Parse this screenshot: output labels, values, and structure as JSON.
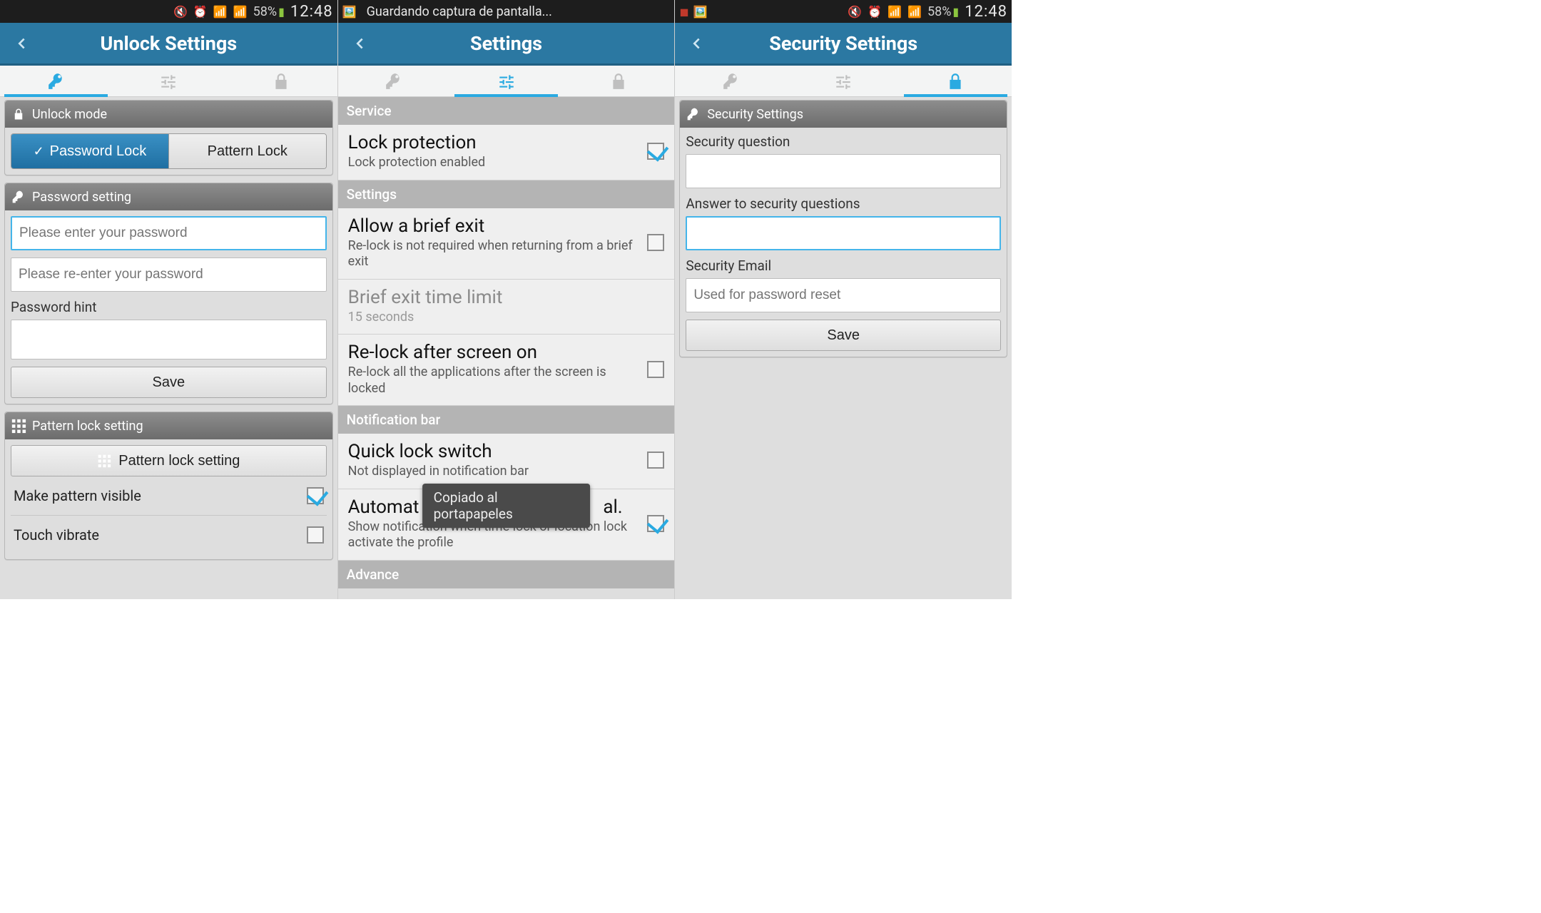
{
  "statusbar": {
    "battery_pct": "58%",
    "clock": "12:48",
    "screenshot_saving": "Guardando captura de pantalla..."
  },
  "screens": {
    "unlock": {
      "header": {
        "title": "Unlock Settings"
      },
      "unlock_mode": {
        "header": "Unlock mode",
        "password_lock": "Password Lock",
        "pattern_lock": "Pattern Lock"
      },
      "password_setting": {
        "header": "Password setting",
        "pw_placeholder": "Please enter your password",
        "pw2_placeholder": "Please re-enter your password",
        "hint_label": "Password hint",
        "save": "Save"
      },
      "pattern_setting": {
        "header": "Pattern lock setting",
        "button": "Pattern lock setting",
        "make_visible": "Make pattern visible",
        "touch_vibrate": "Touch vibrate"
      }
    },
    "settings": {
      "header": {
        "title": "Settings"
      },
      "sections": {
        "service": "Service",
        "settings": "Settings",
        "notification": "Notification bar",
        "advance": "Advance"
      },
      "rows": {
        "lock_protection": {
          "title": "Lock protection",
          "sub": "Lock protection enabled",
          "checked": true
        },
        "allow_brief_exit": {
          "title": "Allow a brief exit",
          "sub": "Re-lock is not required when returning from a brief exit",
          "checked": false
        },
        "brief_limit": {
          "title": "Brief exit time limit",
          "sub": "15 seconds"
        },
        "relock_after": {
          "title": "Re-lock after screen on",
          "sub": "Re-lock all the applications after the screen is locked",
          "checked": false
        },
        "quick_switch": {
          "title": "Quick lock switch",
          "sub": "Not displayed in notification bar",
          "checked": false
        },
        "auto_lock": {
          "title": "Automat",
          "title_tail": "al.",
          "sub": "Show notification when time lock or location lock activate the profile",
          "checked": true
        }
      },
      "toast": "Copiado al portapapeles"
    },
    "security": {
      "header": {
        "title": "Security Settings"
      },
      "panel_header": "Security Settings",
      "question_label": "Security question",
      "answer_label": "Answer to security questions",
      "email_label": "Security Email",
      "email_placeholder": "Used for password reset",
      "save": "Save"
    }
  }
}
